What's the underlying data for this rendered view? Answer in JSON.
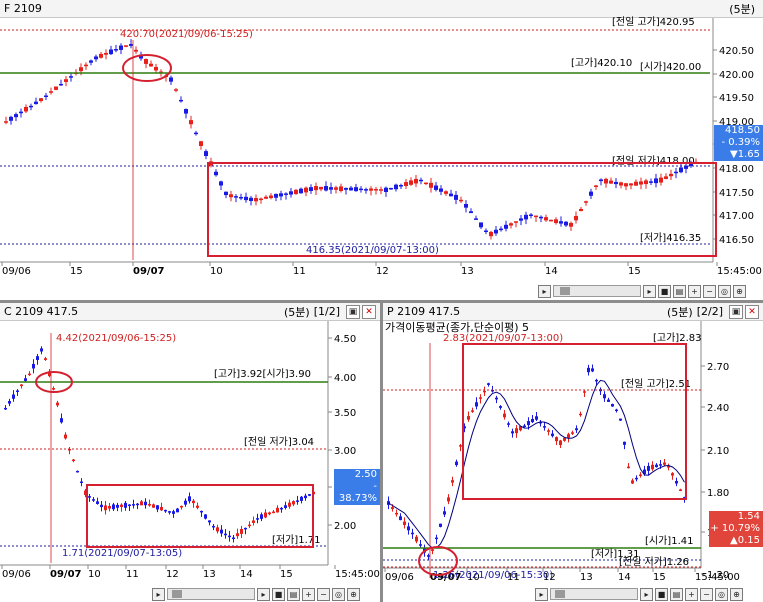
{
  "colors": {
    "up": "#e8201c",
    "down": "#1a1ae6",
    "ma": "#000080",
    "green_line": "#2e7d10",
    "red_dashed": "#d02020",
    "blue_dashed": "#2020a0",
    "highlight_box": "#d42030",
    "badge_blue": "#3a7de8",
    "badge_red": "#e0443a"
  },
  "icons": [
    "play-icon",
    "stop-icon",
    "chart-icon",
    "zoom-in-icon",
    "zoom-out-icon",
    "zoom-reset-icon",
    "zoom-fit-icon",
    "settings-icon",
    "close-icon"
  ],
  "charts": {
    "f": {
      "title": "F 2109",
      "period": "(5분)",
      "x_ticks": [
        "09/06",
        "15",
        "09/07",
        "10",
        "11",
        "12",
        "13",
        "14",
        "15",
        "15:45:00"
      ],
      "y_ticks": [
        "420.50",
        "420.00",
        "419.50",
        "419.00",
        "418.50",
        "418.00",
        "417.50",
        "417.00",
        "416.50"
      ],
      "labels": {
        "prev_high": "[전일 고가]420.95",
        "high": "[고가]420.10",
        "open": "[시가]420.00",
        "prev_low": "[전일 저가]418.00",
        "low": "[저가]416.35",
        "max_marker": "420.70(2021/09/06-15:25)",
        "min_marker": "416.35(2021/09/07-13:00)"
      },
      "badge": {
        "price": "418.50",
        "pct": "- 0.39%",
        "chg": "▼1.65"
      }
    },
    "c": {
      "title": "C 2109 417.5",
      "period": "(5분)",
      "page": "[1/2]",
      "x_ticks": [
        "09/06",
        "09/07",
        "10",
        "11",
        "12",
        "13",
        "14",
        "15",
        "15:45:00"
      ],
      "y_ticks": [
        "4.50",
        "4.00",
        "3.50",
        "3.00",
        "2.50",
        "2.00"
      ],
      "labels": {
        "high": "[고가]3.92",
        "open": "[시가]3.90",
        "prev_low": "[전일 저가]3.04",
        "low": "[저가]1.71",
        "max_marker": "4.42(2021/09/06-15:25)",
        "min_marker": "1.71(2021/09/07-13:05)"
      },
      "badge": {
        "price": "2.50",
        "pct": "- 38.73%",
        "chg": "▼1.58"
      }
    },
    "p": {
      "title": "P 2109 417.5",
      "period": "(5분)",
      "page": "[2/2]",
      "ma_label": "가격이동평균(종가,단순이평) 5",
      "x_ticks": [
        "09/06",
        "09/07",
        "10",
        "11",
        "12",
        "13",
        "14",
        "15",
        "15:45:00"
      ],
      "y_ticks": [
        "2.70",
        "2.40",
        "2.10",
        "1.80",
        "1.50",
        "1.20"
      ],
      "labels": {
        "high": "[고가]2.83",
        "prev_high": "[전일 고가]2.51",
        "open": "[시가]1.41",
        "low": "[저가]1.31",
        "prev_low": "[전일 저가]1.26",
        "max_marker": "2.83(2021/09/07-13:00)",
        "min_marker": "1.26(2021/09/06-15:30)"
      },
      "badge": {
        "price": "1.54",
        "pct": "+ 10.79%",
        "chg": "▲0.15"
      }
    }
  }
}
